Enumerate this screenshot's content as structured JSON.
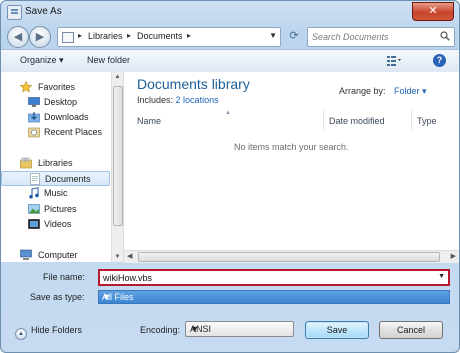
{
  "window": {
    "title": "Save As",
    "close_glyph": "✕"
  },
  "address": {
    "crumbs": [
      "Libraries",
      "Documents"
    ],
    "separator": "▸"
  },
  "search": {
    "placeholder": "Search Documents"
  },
  "toolbar": {
    "organize": "Organize ▾",
    "new_folder": "New folder",
    "help": "?"
  },
  "nav": {
    "items": [
      {
        "label": "Favorites",
        "icon": "star-icon",
        "level": 0
      },
      {
        "label": "Desktop",
        "icon": "desktop-icon",
        "level": 1
      },
      {
        "label": "Downloads",
        "icon": "downloads-icon",
        "level": 1
      },
      {
        "label": "Recent Places",
        "icon": "recent-places-icon",
        "level": 1
      },
      {
        "label": "Libraries",
        "icon": "libraries-icon",
        "level": 0
      },
      {
        "label": "Documents",
        "icon": "documents-icon",
        "level": 1,
        "selected": true
      },
      {
        "label": "Music",
        "icon": "music-icon",
        "level": 1
      },
      {
        "label": "Pictures",
        "icon": "pictures-icon",
        "level": 1
      },
      {
        "label": "Videos",
        "icon": "videos-icon",
        "level": 1
      },
      {
        "label": "Computer",
        "icon": "computer-icon",
        "level": 0
      }
    ]
  },
  "main": {
    "library_title": "Documents library",
    "includes_label": "Includes:",
    "includes_link": "2 locations",
    "arrange_label": "Arrange by:",
    "arrange_value": "Folder ▾",
    "columns": [
      "Name",
      "Date modified",
      "Type"
    ],
    "empty_message": "No items match your search."
  },
  "form": {
    "file_name_label": "File name:",
    "file_name_value": "wikiHow.vbs",
    "save_type_label": "Save as type:",
    "save_type_value": "All Files",
    "hide_folders": "Hide Folders",
    "encoding_label": "Encoding:",
    "encoding_value": "ANSI",
    "save_button": "Save",
    "cancel_button": "Cancel"
  },
  "colors": {
    "accent": "#1e5f9a",
    "highlight": "#b8182c",
    "selection": "#3d86d4"
  }
}
